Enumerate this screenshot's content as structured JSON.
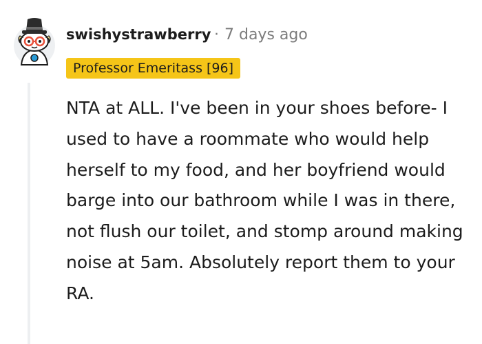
{
  "comment": {
    "username": "swishystrawberry",
    "separator": "·",
    "timestamp": "7 days ago",
    "flair": "Professor Emeritass [96]",
    "body": "NTA at ALL. I've been in your shoes before- I used to have a roommate who would help herself to my food, and her boyfriend would barge into our bathroom while I was in there, not flush our toilet, and stomp around making noise at 5am. Absolutely report them to your RA."
  },
  "avatar": {
    "icon": "snoo-avatar-icon"
  },
  "colors": {
    "flair_background": "#f5c518",
    "meta_text": "#7c7c7c",
    "body_text": "#1c1c1c",
    "thread_line": "#edeff1"
  }
}
